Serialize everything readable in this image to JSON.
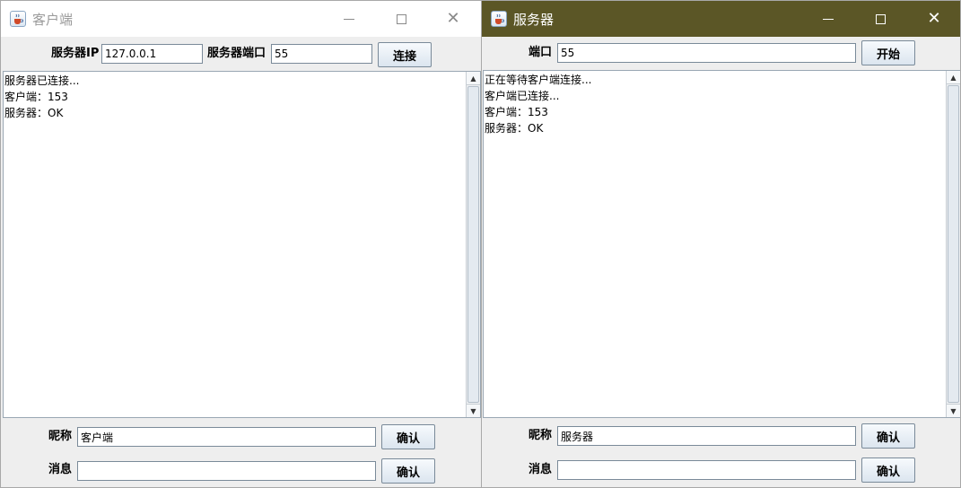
{
  "client": {
    "title": "客户端",
    "ip_label": "服务器IP",
    "ip_value": "127.0.0.1",
    "port_label": "服务器端口",
    "port_value": "55",
    "connect_button": "连接",
    "log": [
      "服务器已连接...",
      "客户端：153",
      "服务器：OK"
    ],
    "nickname_label": "昵称",
    "nickname_value": "客户端",
    "nickname_confirm": "确认",
    "message_label": "消息",
    "message_value": "",
    "message_confirm": "确认"
  },
  "server": {
    "title": "服务器",
    "port_label": "端口",
    "port_value": "55",
    "start_button": "开始",
    "log": [
      "正在等待客户端连接...",
      "客户端已连接...",
      "客户端：153",
      "服务器：OK"
    ],
    "nickname_label": "昵称",
    "nickname_value": "服务器",
    "nickname_confirm": "确认",
    "message_label": "消息",
    "message_value": "",
    "message_confirm": "确认"
  },
  "icons": {
    "app": "java-cup-icon",
    "minimize": "minimize-icon",
    "maximize": "maximize-icon",
    "close": "close-icon",
    "scroll_up": "scroll-up-arrow-icon",
    "scroll_down": "scroll-down-arrow-icon"
  },
  "colors": {
    "server_titlebar": "#5b5626",
    "client_titlebar": "#ffffff",
    "window_bg": "#eeeeee"
  }
}
